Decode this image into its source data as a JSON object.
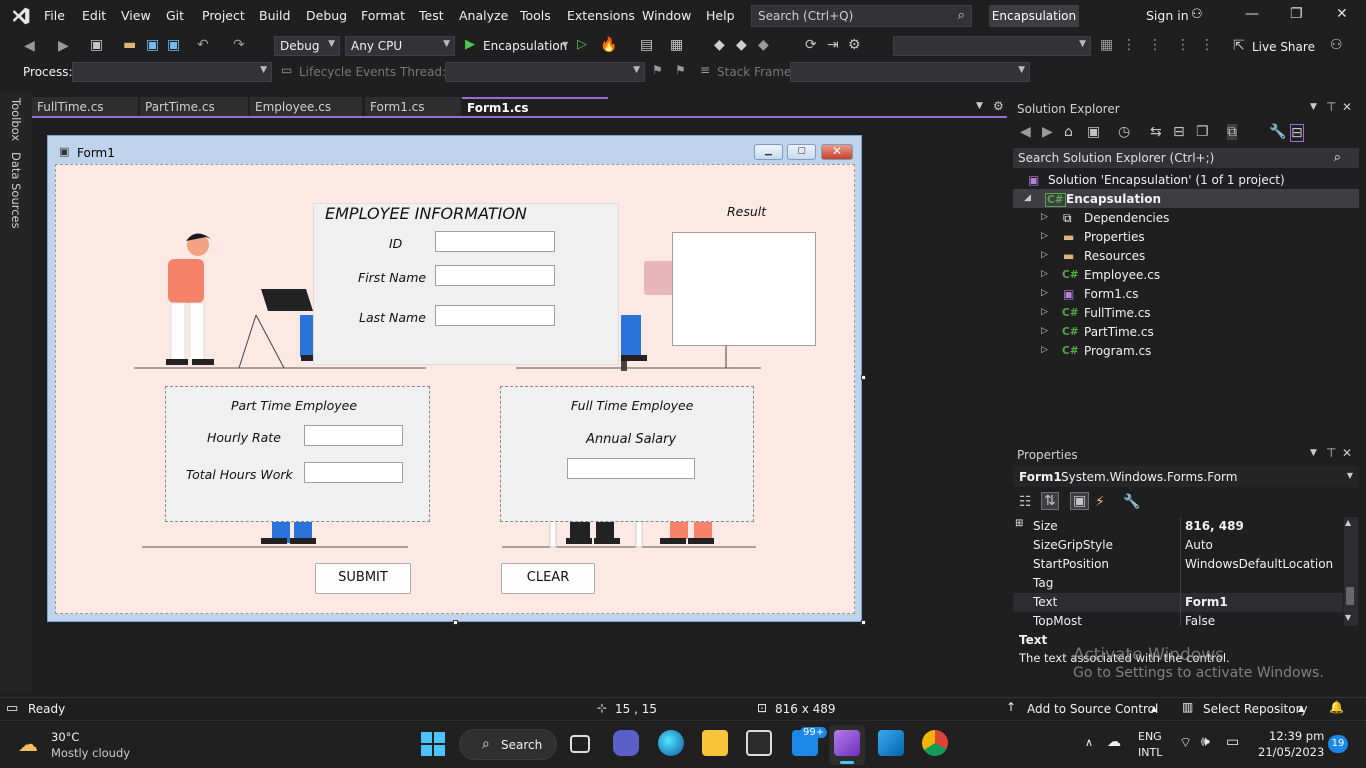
{
  "menu": [
    "File",
    "Edit",
    "View",
    "Git",
    "Project",
    "Build",
    "Debug",
    "Format",
    "Test",
    "Analyze",
    "Tools",
    "Extensions",
    "Window",
    "Help"
  ],
  "search": {
    "placeholder": "Search (Ctrl+Q)"
  },
  "solution_badge": "Encapsulation",
  "signin": "Sign in",
  "toolbar": {
    "config": "Debug",
    "platform": "Any CPU",
    "start": "Encapsulation",
    "liveshare": "Live Share"
  },
  "toolbar2": {
    "process": "Process:",
    "lifecycle": "Lifecycle Events",
    "thread": "Thread:",
    "stackframe": "Stack Frame:"
  },
  "side": {
    "toolbox": "Toolbox",
    "datasources": "Data Sources"
  },
  "tabs": [
    "FullTime.cs",
    "PartTime.cs",
    "Employee.cs",
    "Form1.cs",
    "Form1.cs [Design]"
  ],
  "form": {
    "title": "Form1",
    "emp_header": "EMPLOYEE INFORMATION",
    "id_label": "ID",
    "first_label": "First Name",
    "last_label": "Last Name",
    "result_label": "Result",
    "part_header": "Part Time Employee",
    "hourly_label": "Hourly Rate",
    "hours_label": "Total Hours Work",
    "full_header": "Full Time Employee",
    "salary_label": "Annual Salary",
    "submit": "SUBMIT",
    "clear": "CLEAR"
  },
  "solution_explorer": {
    "title": "Solution Explorer",
    "search": "Search Solution Explorer (Ctrl+;)",
    "solution": "Solution 'Encapsulation' (1 of 1 project)",
    "project": "Encapsulation",
    "items": [
      "Dependencies",
      "Properties",
      "Resources",
      "Employee.cs",
      "Form1.cs",
      "FullTime.cs",
      "PartTime.cs",
      "Program.cs"
    ]
  },
  "properties": {
    "title": "Properties",
    "object": "Form1",
    "type": "System.Windows.Forms.Form",
    "rows": [
      {
        "name": "Size",
        "value": "816, 489"
      },
      {
        "name": "SizeGripStyle",
        "value": "Auto"
      },
      {
        "name": "StartPosition",
        "value": "WindowsDefaultLocation"
      },
      {
        "name": "Tag",
        "value": ""
      },
      {
        "name": "Text",
        "value": "Form1"
      },
      {
        "name": "TopMost",
        "value": "False"
      }
    ],
    "desc_title": "Text",
    "desc": "The text associated with the control."
  },
  "watermark": {
    "line1": "Activate Windows",
    "line2": "Go to Settings to activate Windows."
  },
  "status": {
    "ready": "Ready",
    "pos": "15 , 15",
    "size": "816 x 489",
    "source": "Add to Source Control",
    "repo": "Select Repository"
  },
  "taskbar": {
    "temp": "30°C",
    "weather": "Mostly cloudy",
    "search": "Search",
    "badge": "99+",
    "lang1": "ENG",
    "lang2": "INTL",
    "time": "12:39 pm",
    "date": "21/05/2023",
    "notif": "19"
  }
}
